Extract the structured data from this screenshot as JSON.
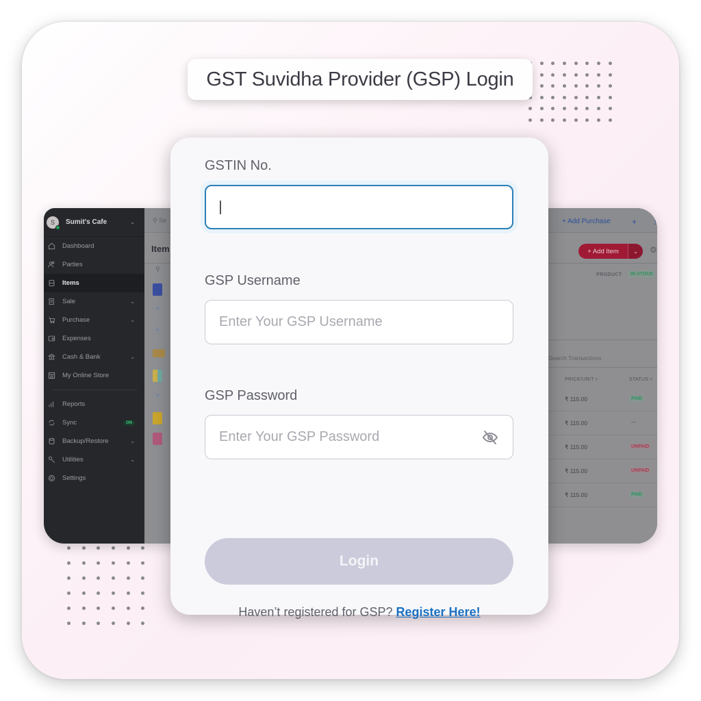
{
  "title": "GST Suvidha Provider (GSP) Login",
  "form": {
    "gstin": {
      "label": "GSTIN No.",
      "value": "",
      "placeholder": ""
    },
    "username": {
      "label": "GSP Username",
      "value": "",
      "placeholder": "Enter Your GSP Username"
    },
    "password": {
      "label": "GSP Password",
      "value": "",
      "placeholder": "Enter Your GSP Password",
      "toggle_icon": "eye-off-icon"
    },
    "login_button": "Login",
    "register_prompt": "Haven’t registered for GSP?",
    "register_link": "Register Here!"
  },
  "background_app": {
    "business_name": "Sumit's Cafe",
    "avatar_initial": "S",
    "search_placeholder": "Se",
    "page_title": "Item",
    "sidebar": [
      {
        "label": "Dashboard",
        "icon": "home-icon"
      },
      {
        "label": "Parties",
        "icon": "users-icon"
      },
      {
        "label": "Items",
        "icon": "box-icon",
        "active": true
      },
      {
        "label": "Sale",
        "icon": "receipt-icon",
        "chevron": true
      },
      {
        "label": "Purchase",
        "icon": "cart-icon",
        "chevron": true
      },
      {
        "label": "Expenses",
        "icon": "wallet-icon"
      },
      {
        "label": "Cash & Bank",
        "icon": "bank-icon",
        "chevron": true
      },
      {
        "label": "My Online Store",
        "icon": "store-icon"
      },
      {
        "label": "Reports",
        "icon": "chart-icon"
      },
      {
        "label": "Sync",
        "icon": "sync-icon",
        "badge": "ON"
      },
      {
        "label": "Backup/Restore",
        "icon": "database-icon",
        "chevron": true
      },
      {
        "label": "Utilities",
        "icon": "wrench-icon",
        "chevron": true
      },
      {
        "label": "Settings",
        "icon": "gear-icon"
      }
    ],
    "add_purchase": "+ Add Purchase",
    "add_item": "+ Add Item",
    "product_col": "PRODUCT",
    "in_stock": "IN STOCK",
    "search_transactions": "Search Transactions",
    "columns": {
      "price": "PRICE/UNIT",
      "status": "STATUS"
    },
    "transactions": [
      {
        "price": "₹ 115.00",
        "status": "PAID",
        "kind": "paid"
      },
      {
        "price": "₹ 115.00",
        "status": "—",
        "kind": "none"
      },
      {
        "price": "₹ 115.00",
        "status": "UNPAID",
        "kind": "unpaid"
      },
      {
        "price": "₹ 115.00",
        "status": "UNPAID",
        "kind": "unpaid"
      },
      {
        "price": "₹ 115.00",
        "status": "PAID",
        "kind": "paid"
      }
    ]
  },
  "colors": {
    "accent_blue": "#2b7fb8",
    "link_blue": "#1a70c2",
    "login_disabled": "#cccbdb",
    "brand_red": "#a01a35",
    "sidebar_bg": "#25272b"
  }
}
